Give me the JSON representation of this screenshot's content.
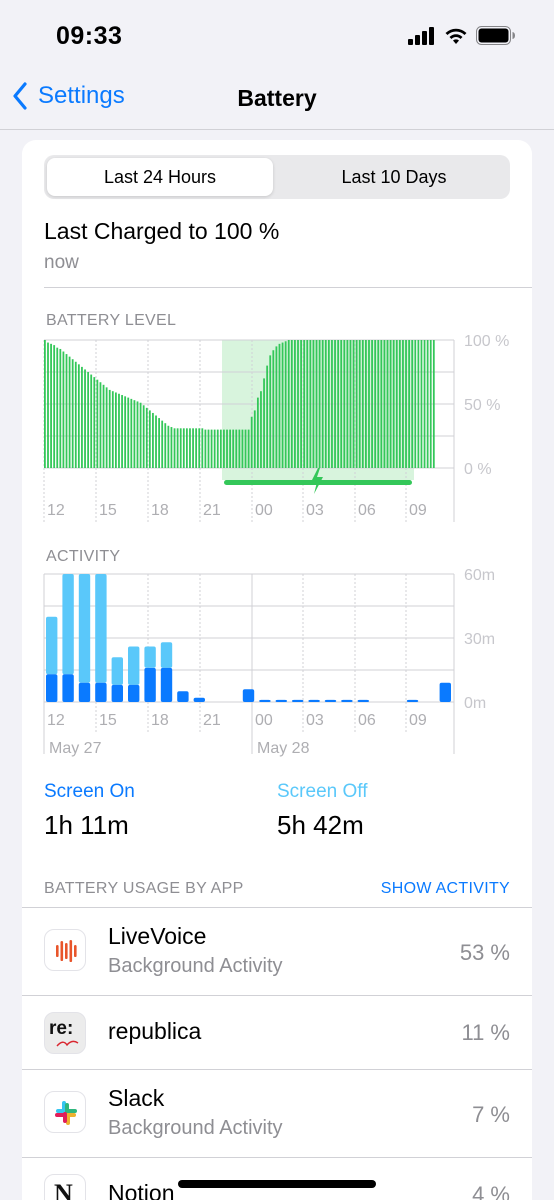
{
  "status_bar": {
    "time": "09:33"
  },
  "nav": {
    "back_label": "Settings",
    "title": "Battery"
  },
  "segmented": {
    "selected": "Last 24 Hours",
    "other": "Last 10 Days"
  },
  "last_charged": {
    "title": "Last Charged to 100 %",
    "subtitle": "now"
  },
  "colors": {
    "accent": "#0a7aff",
    "battery_green": "#34c759",
    "charging_bg": "#c8f0cf",
    "screen_on": "#0a7aff",
    "screen_off": "#5ac8fa"
  },
  "chart_data": [
    {
      "type": "bar",
      "title": "BATTERY LEVEL",
      "ylim": [
        0,
        100
      ],
      "y_ticks": [
        "100 %",
        "50 %",
        "0 %"
      ],
      "x_ticks": [
        "12",
        "15",
        "18",
        "21",
        "00",
        "03",
        "06",
        "09"
      ],
      "charging_indicator": "charging",
      "values": [
        100,
        98,
        97,
        96,
        94,
        93,
        91,
        89,
        87,
        85,
        83,
        81,
        79,
        77,
        75,
        73,
        71,
        69,
        67,
        65,
        63,
        61,
        60,
        59,
        58,
        57,
        56,
        55,
        54,
        53,
        52,
        51,
        49,
        47,
        45,
        43,
        41,
        39,
        37,
        35,
        33,
        32,
        31,
        31,
        31,
        31,
        31,
        31,
        31,
        31,
        31,
        31,
        30,
        30,
        30,
        30,
        30,
        30,
        30,
        30,
        30,
        30,
        30,
        30,
        30,
        30,
        30,
        40,
        45,
        55,
        60,
        70,
        80,
        88,
        92,
        95,
        97,
        98,
        99,
        100,
        100,
        100,
        100,
        100,
        100,
        100,
        100,
        100,
        100,
        100,
        100,
        100,
        100,
        100,
        100,
        100,
        100,
        100,
        100,
        100,
        100,
        100,
        100,
        100,
        100,
        100,
        100,
        100,
        100,
        100,
        100,
        100,
        100,
        100,
        100,
        100,
        100,
        100,
        100,
        100,
        100,
        100,
        100,
        100,
        100,
        100,
        100
      ]
    },
    {
      "type": "bar",
      "title": "ACTIVITY",
      "ylim": [
        0,
        60
      ],
      "y_ticks": [
        "60m",
        "30m",
        "0m"
      ],
      "x_ticks": [
        "12",
        "15",
        "18",
        "21",
        "00",
        "03",
        "06",
        "09"
      ],
      "date_labels": [
        "May 27",
        "May 28"
      ],
      "series": [
        {
          "name": "Screen On",
          "values": [
            13,
            13,
            9,
            9,
            8,
            8,
            16,
            16,
            5,
            2,
            0,
            0,
            6,
            1,
            1,
            1,
            1,
            1,
            1,
            1,
            0,
            0,
            1,
            0,
            9
          ]
        },
        {
          "name": "Screen Off",
          "values": [
            27,
            47,
            51,
            51,
            13,
            18,
            10,
            12,
            0,
            0,
            0,
            0,
            0,
            0,
            0,
            0,
            0,
            0,
            0,
            0,
            0,
            0,
            0,
            0,
            0
          ]
        }
      ]
    }
  ],
  "legend": {
    "screen_on_label": "Screen On",
    "screen_on_value": "1h 11m",
    "screen_off_label": "Screen Off",
    "screen_off_value": "5h 42m"
  },
  "usage": {
    "header": "BATTERY USAGE BY APP",
    "show_activity": "SHOW ACTIVITY",
    "apps": [
      {
        "name": "LiveVoice",
        "subtitle": "Background Activity",
        "percent": "53 %",
        "icon": "livevoice-icon"
      },
      {
        "name": "republica",
        "subtitle": "",
        "percent": "11 %",
        "icon": "republica-icon",
        "icon_text": "re:"
      },
      {
        "name": "Slack",
        "subtitle": "Background Activity",
        "percent": "7 %",
        "icon": "slack-icon"
      },
      {
        "name": "Notion",
        "subtitle": "",
        "percent": "4 %",
        "icon": "notion-icon",
        "icon_text": "N"
      }
    ]
  }
}
